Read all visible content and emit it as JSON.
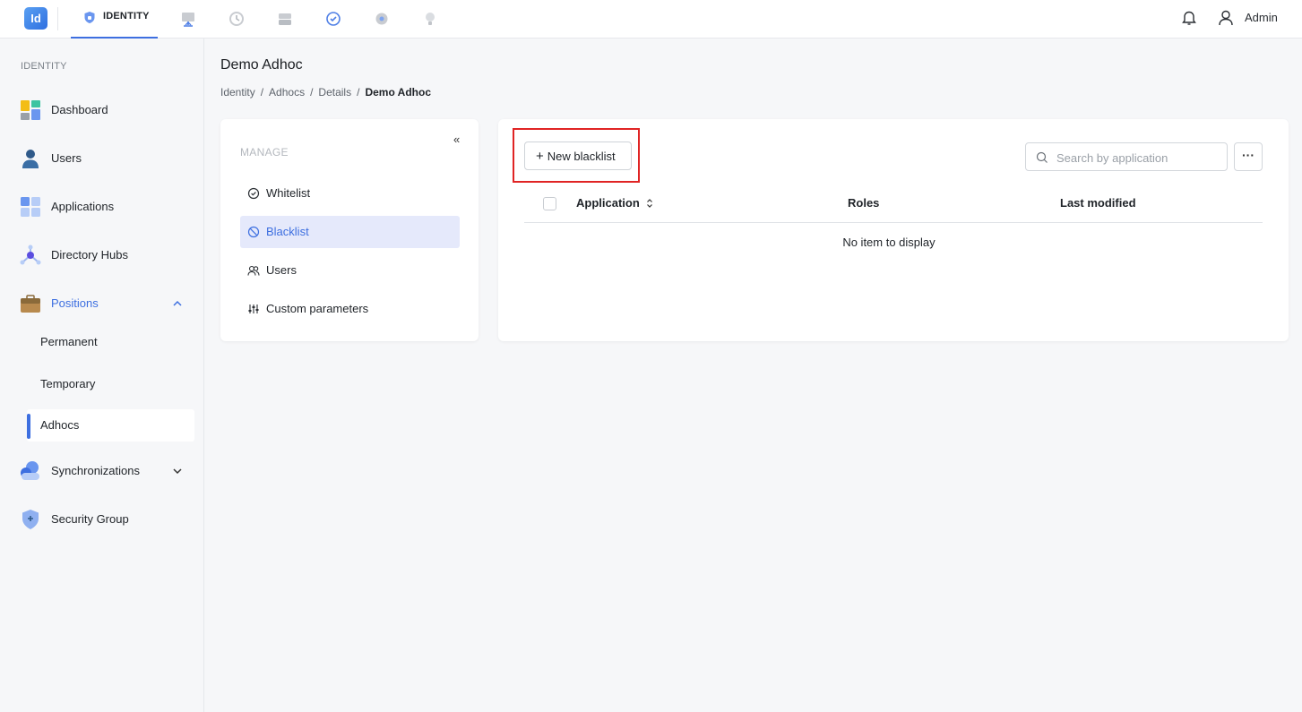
{
  "header": {
    "logo": "Id",
    "active_tab": "IDENTITY",
    "user": "Admin",
    "app_icons": [
      "monitor-icon",
      "history-icon",
      "storage-icon",
      "check-circle-icon",
      "settings-icon",
      "lightbulb-icon"
    ]
  },
  "sidebar": {
    "section": "IDENTITY",
    "items": [
      {
        "label": "Dashboard",
        "icon": "dashboard-icon"
      },
      {
        "label": "Users",
        "icon": "user-icon"
      },
      {
        "label": "Applications",
        "icon": "applications-icon"
      },
      {
        "label": "Directory Hubs",
        "icon": "hub-icon"
      },
      {
        "label": "Positions",
        "icon": "briefcase-icon",
        "expanded": true
      },
      {
        "label": "Synchronizations",
        "icon": "cloud-sync-icon",
        "expanded": false
      },
      {
        "label": "Security Group",
        "icon": "shield-icon"
      }
    ],
    "positions_sub": [
      "Permanent",
      "Temporary",
      "Adhocs"
    ]
  },
  "page": {
    "title": "Demo Adhoc",
    "breadcrumb": [
      "Identity",
      "Adhocs",
      "Details",
      "Demo Adhoc"
    ]
  },
  "manage": {
    "collapse": "«",
    "label": "MANAGE",
    "items": [
      {
        "label": "Whitelist",
        "icon": "check-circle-icon"
      },
      {
        "label": "Blacklist",
        "icon": "ban-icon",
        "active": true
      },
      {
        "label": "Users",
        "icon": "users-icon"
      },
      {
        "label": "Custom parameters",
        "icon": "sliders-icon"
      }
    ]
  },
  "table": {
    "new_button": "New blacklist",
    "search_placeholder": "Search by application",
    "more": "···",
    "columns": [
      "Application",
      "Roles",
      "Last modified"
    ],
    "empty": "No item to display"
  },
  "colors": {
    "accent": "#3d6fe0",
    "highlight": "#e02424",
    "active_bg": "#e5e9fb"
  }
}
